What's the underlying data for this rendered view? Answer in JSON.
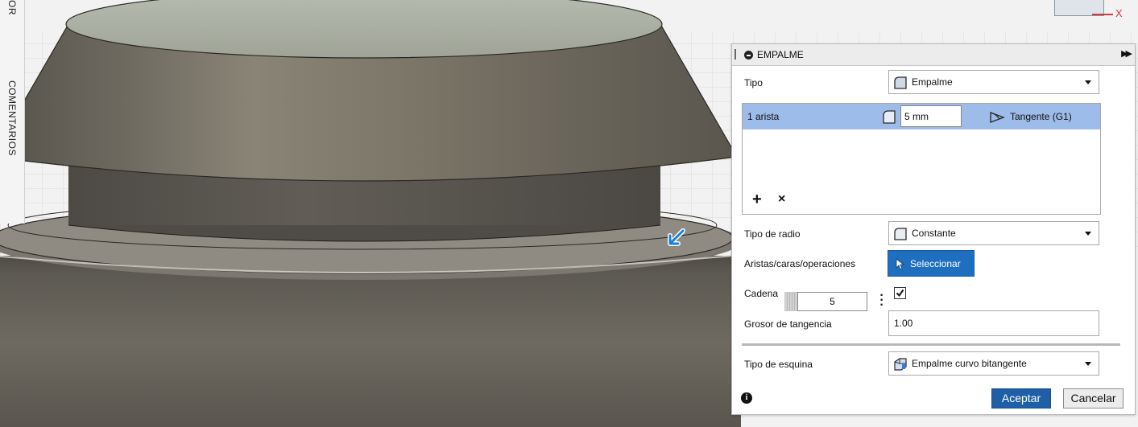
{
  "viewport": {
    "left_strip": {
      "label_top": "OR",
      "label_comments": "COMENTARIOS"
    },
    "axis_x_label": "X",
    "colors": {
      "background": "#f2f2f2",
      "model_metal": "#7a7366",
      "grid": "#d5d5d5"
    }
  },
  "panel": {
    "title": "EMPALME",
    "tipo": {
      "label": "Tipo",
      "value": "Empalme",
      "icon": "fillet-icon"
    },
    "edge_table": {
      "rows": [
        {
          "name": "1 arista",
          "radius": "5 mm",
          "continuity": "Tangente (G1)"
        }
      ],
      "add_symbol": "+",
      "remove_symbol": "×"
    },
    "radius_type": {
      "label": "Tipo de radio",
      "value": "Constante"
    },
    "selection": {
      "label": "Aristas/caras/operaciones",
      "button": "Seleccionar"
    },
    "chain": {
      "label": "Cadena",
      "count": "5",
      "checked": true
    },
    "tangency_weight": {
      "label": "Grosor de tangencia",
      "value": "1.00"
    },
    "corner_type": {
      "label": "Tipo de esquina",
      "value": "Empalme curvo bitangente"
    },
    "footer": {
      "info_symbol": "i",
      "ok": "Aceptar",
      "cancel": "Cancelar"
    },
    "colors": {
      "selected_row": "#9dbcea",
      "primary_button": "#1f6fc0",
      "ok_button": "#1f5fa8"
    }
  }
}
